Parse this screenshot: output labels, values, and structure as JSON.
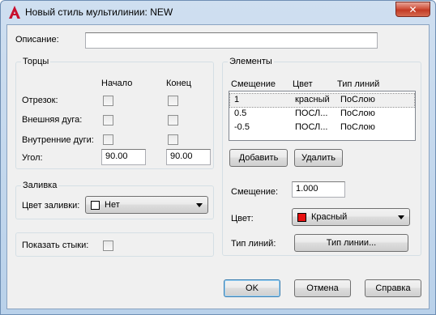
{
  "window": {
    "title": "Новый стиль мультилинии: NEW",
    "close_glyph": "✕"
  },
  "description": {
    "label": "Описание:",
    "value": ""
  },
  "caps": {
    "title": "Торцы",
    "col_start": "Начало",
    "col_end": "Конец",
    "rows": [
      {
        "label": "Отрезок:",
        "start_checked": false,
        "end_checked": false
      },
      {
        "label": "Внешняя дуга:",
        "start_checked": false,
        "end_checked": false
      },
      {
        "label": "Внутренние дуги:",
        "start_checked": false,
        "end_checked": false
      }
    ],
    "angle_label": "Угол:",
    "angle_start": "90.00",
    "angle_end": "90.00"
  },
  "fill": {
    "title": "Заливка",
    "color_label": "Цвет заливки:",
    "color_value": "Нет",
    "swatch_color": "#ffffff"
  },
  "joints": {
    "label": "Показать стыки:",
    "checked": false
  },
  "elements": {
    "title": "Элементы",
    "columns": [
      "Смещение",
      "Цвет",
      "Тип линий"
    ],
    "rows": [
      [
        "1",
        "красный",
        "ПоСлою"
      ],
      [
        "0.5",
        "ПОСЛ...",
        "ПоСлою"
      ],
      [
        "-0.5",
        "ПОСЛ...",
        "ПоСлою"
      ]
    ],
    "add_label": "Добавить",
    "delete_label": "Удалить",
    "offset_label": "Смещение:",
    "offset_value": "1.000",
    "color_label": "Цвет:",
    "color_value": "Красный",
    "color_swatch": "#e81010",
    "linetype_label": "Тип линий:",
    "linetype_button": "Тип линии..."
  },
  "buttons": {
    "ok": "OK",
    "cancel": "Отмена",
    "help": "Справка"
  },
  "colors": {
    "app_icon": "#c8102e",
    "accent": "#3c7fb1"
  }
}
